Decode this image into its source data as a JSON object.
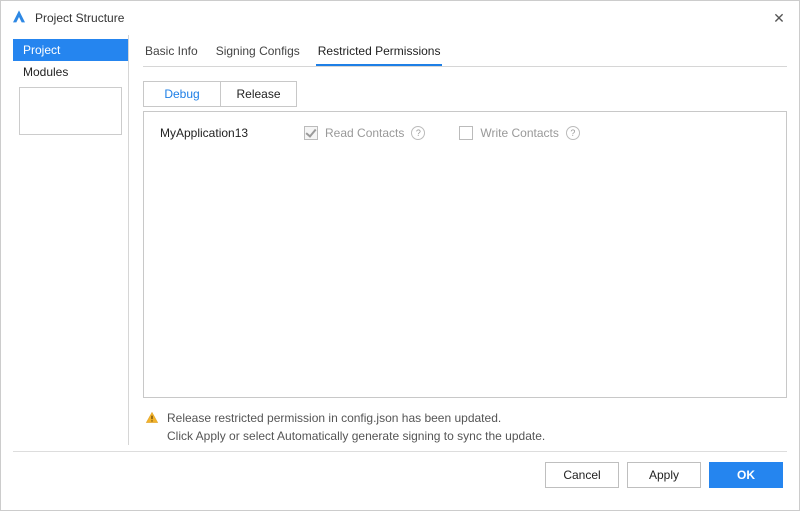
{
  "title": "Project Structure",
  "sidebar": {
    "items": [
      {
        "label": "Project",
        "selected": true
      },
      {
        "label": "Modules",
        "selected": false
      }
    ]
  },
  "topTabs": [
    {
      "label": "Basic Info",
      "active": false
    },
    {
      "label": "Signing Configs",
      "active": false
    },
    {
      "label": "Restricted Permissions",
      "active": true
    }
  ],
  "subTabs": [
    {
      "label": "Debug",
      "active": true
    },
    {
      "label": "Release",
      "active": false
    }
  ],
  "appName": "MyApplication13",
  "permissions": [
    {
      "label": "Read Contacts",
      "checked": true
    },
    {
      "label": "Write Contacts",
      "checked": false
    }
  ],
  "warning": {
    "line1": "Release restricted permission in config.json has been updated.",
    "line2": "Click Apply or select Automatically generate signing to sync the update."
  },
  "buttons": {
    "cancel": "Cancel",
    "apply": "Apply",
    "ok": "OK"
  },
  "help": "?"
}
